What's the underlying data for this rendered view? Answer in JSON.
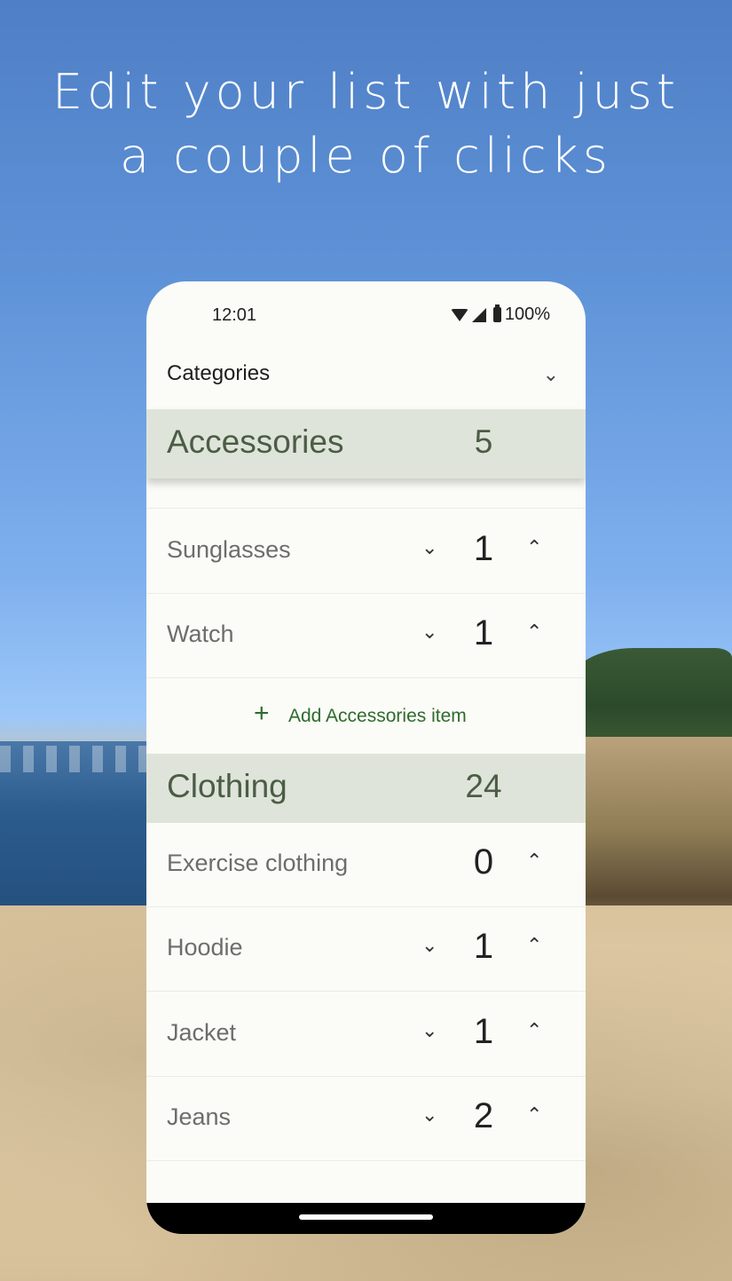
{
  "headline": {
    "line1": "Edit your list with just",
    "line2": "a couple of clicks"
  },
  "status_bar": {
    "time": "12:01",
    "battery": "100%"
  },
  "dropdown": {
    "label": "Categories",
    "icon": "chevron-down-icon"
  },
  "categories": [
    {
      "name": "Accessories",
      "count": "5",
      "items": [
        {
          "name": "Sunglasses",
          "qty": "1"
        },
        {
          "name": "Watch",
          "qty": "1"
        }
      ],
      "add_label": "Add Accessories item"
    },
    {
      "name": "Clothing",
      "count": "24",
      "items": [
        {
          "name": "Exercise clothing",
          "qty": "0"
        },
        {
          "name": "Hoodie",
          "qty": "1"
        },
        {
          "name": "Jacket",
          "qty": "1"
        },
        {
          "name": "Jeans",
          "qty": "2"
        }
      ]
    }
  ],
  "glyphs": {
    "decrement": "⌄",
    "increment": "⌃",
    "dropdown": "⌄",
    "add": "+"
  },
  "colors": {
    "header_bg": "#dfe4da",
    "header_text": "#4b5d45",
    "accent_green": "#2e6b2e",
    "screen_bg": "#fbfbf7"
  }
}
